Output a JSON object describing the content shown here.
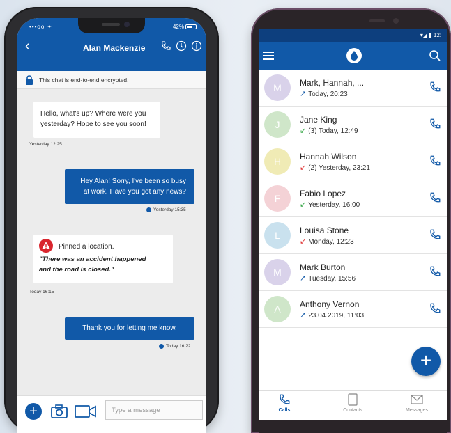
{
  "chat": {
    "title": "Alan Mackenzie",
    "status_left": "•••oo ✦",
    "status_right": "42%",
    "encryption_note": "This chat is end-to-end encrypted.",
    "messages": [
      {
        "dir": "in",
        "text1": "Hello, what's up? Where were you",
        "text2": "yesterday? Hope to see you soon!",
        "time": "Yesterday 12:25"
      },
      {
        "dir": "out",
        "text1": "Hey Alan! Sorry, I've been so busy",
        "text2": "at work. Have you got any news?",
        "time": "Yesterday 15:35"
      },
      {
        "dir": "in",
        "pinned": "Pinned a location.",
        "text1": "\"There was an accident happened",
        "text2": "and the road is closed.\"",
        "time": "Today 16:15"
      },
      {
        "dir": "out",
        "text1": "Thank you for letting me know.",
        "time": "Today 16:22"
      }
    ],
    "input_placeholder": "Type a message"
  },
  "calls": {
    "status_right": "▾◢ ▮ 12:",
    "rows": [
      {
        "initial": "M",
        "name": "Mark, Hannah, ...",
        "detail": "Today, 20:23",
        "arrow": "↗",
        "arrow_color": "#1159a8",
        "avatar_color": "#d9d2ea"
      },
      {
        "initial": "J",
        "name": "Jane King",
        "detail": "(3) Today, 12:49",
        "arrow": "↙",
        "arrow_color": "#3aa84a",
        "avatar_color": "#cfe6c9"
      },
      {
        "initial": "H",
        "name": "Hannah Wilson",
        "detail": "(2) Yesterday, 23:21",
        "arrow": "↙",
        "arrow_color": "#e03b3b",
        "avatar_color": "#f0ebb5"
      },
      {
        "initial": "F",
        "name": "Fabio Lopez",
        "detail": "Yesterday, 16:00",
        "arrow": "↙",
        "arrow_color": "#3aa84a",
        "avatar_color": "#f4d2d6"
      },
      {
        "initial": "L",
        "name": "Louisa Stone",
        "detail": "Monday, 12:23",
        "arrow": "↙",
        "arrow_color": "#e03b3b",
        "avatar_color": "#c9e1ee"
      },
      {
        "initial": "M",
        "name": "Mark Burton",
        "detail": "Tuesday, 15:56",
        "arrow": "↗",
        "arrow_color": "#1159a8",
        "avatar_color": "#d9d2ea"
      },
      {
        "initial": "A",
        "name": "Anthony Vernon",
        "detail": "23.04.2019, 11:03",
        "arrow": "↗",
        "arrow_color": "#1159a8",
        "avatar_color": "#cfe6c9"
      }
    ],
    "nav": {
      "calls": "Calls",
      "contacts": "Contacts",
      "messages": "Messages"
    }
  },
  "colors": {
    "brand": "#1159a8"
  }
}
